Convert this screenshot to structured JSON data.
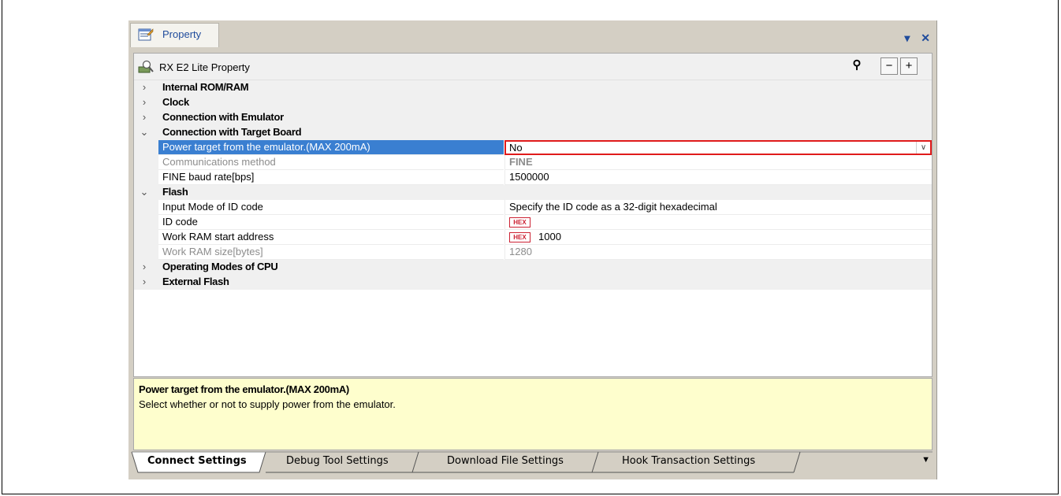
{
  "window": {
    "tab_title": "Property",
    "dropdown_glyph": "▾",
    "close_glyph": "✕"
  },
  "header": {
    "title": "RX E2 Lite Property",
    "search_glyph": "⚲",
    "collapse_glyph": "−",
    "expand_glyph": "+"
  },
  "categories": {
    "internal_rom_ram": "Internal ROM/RAM",
    "clock": "Clock",
    "connection_emulator": "Connection with Emulator",
    "connection_target": "Connection with Target Board",
    "flash": "Flash",
    "operating_modes": "Operating Modes of CPU",
    "external_flash": "External Flash"
  },
  "props": {
    "power_target": {
      "name": "Power target from the emulator.(MAX 200mA)",
      "value": "No"
    },
    "comm_method": {
      "name": "Communications method",
      "value": "FINE"
    },
    "fine_baud": {
      "name": "FINE baud rate[bps]",
      "value": "1500000"
    },
    "input_mode": {
      "name": "Input Mode of ID code",
      "value": "Specify the ID code as a 32-digit hexadecimal"
    },
    "id_code": {
      "name": "ID code",
      "value": ""
    },
    "work_ram_start": {
      "name": "Work RAM start address",
      "value": "1000"
    },
    "work_ram_size": {
      "name": "Work RAM size[bytes]",
      "value": "1280"
    }
  },
  "hex_badge": "HEX",
  "description": {
    "title": "Power target from the emulator.(MAX 200mA)",
    "text": "Select whether or not to supply power from the emulator."
  },
  "bottom_tabs": [
    "Connect Settings",
    "Debug Tool Settings",
    "Download File Settings",
    "Hook Transaction Settings"
  ],
  "bottom_arrow": "▼"
}
